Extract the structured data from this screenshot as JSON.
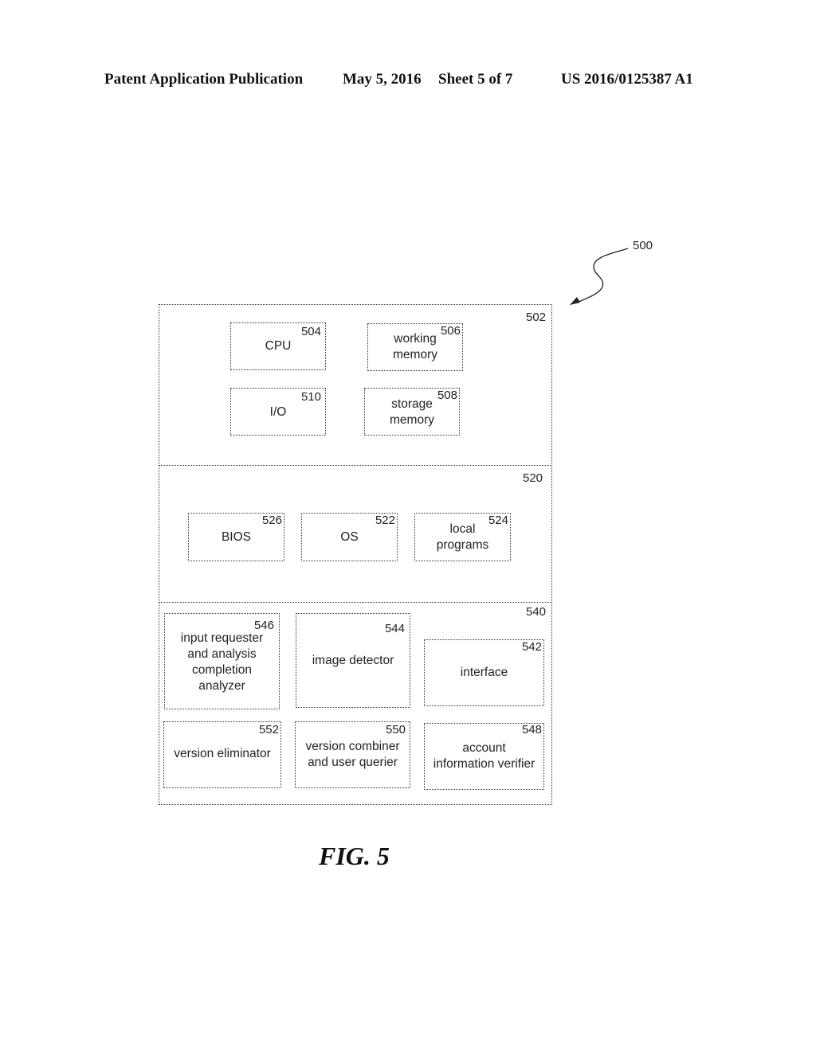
{
  "header": {
    "publication": "Patent Application Publication",
    "date": "May 5, 2016",
    "sheet": "Sheet 5 of 7",
    "patent_number": "US 2016/0125387 A1"
  },
  "diagram": {
    "ref": "500",
    "sections": [
      {
        "ref": "502",
        "blocks": [
          {
            "ref": "504",
            "label": "CPU"
          },
          {
            "ref": "506",
            "label": "working\nmemory"
          },
          {
            "ref": "510",
            "label": "I/O"
          },
          {
            "ref": "508",
            "label": "storage\nmemory"
          }
        ]
      },
      {
        "ref": "520",
        "blocks": [
          {
            "ref": "526",
            "label": "BIOS"
          },
          {
            "ref": "522",
            "label": "OS"
          },
          {
            "ref": "524",
            "label": "local\nprograms"
          }
        ]
      },
      {
        "ref": "540",
        "blocks": [
          {
            "ref": "546",
            "label": "input requester\nand analysis\ncompletion\nanalyzer"
          },
          {
            "ref": "544",
            "label": "image detector"
          },
          {
            "ref": "542",
            "label": "interface"
          },
          {
            "ref": "552",
            "label": "version eliminator"
          },
          {
            "ref": "550",
            "label": "version combiner\nand user querier"
          },
          {
            "ref": "548",
            "label": "account\ninformation verifier"
          }
        ]
      }
    ]
  },
  "figure_caption": "FIG. 5"
}
